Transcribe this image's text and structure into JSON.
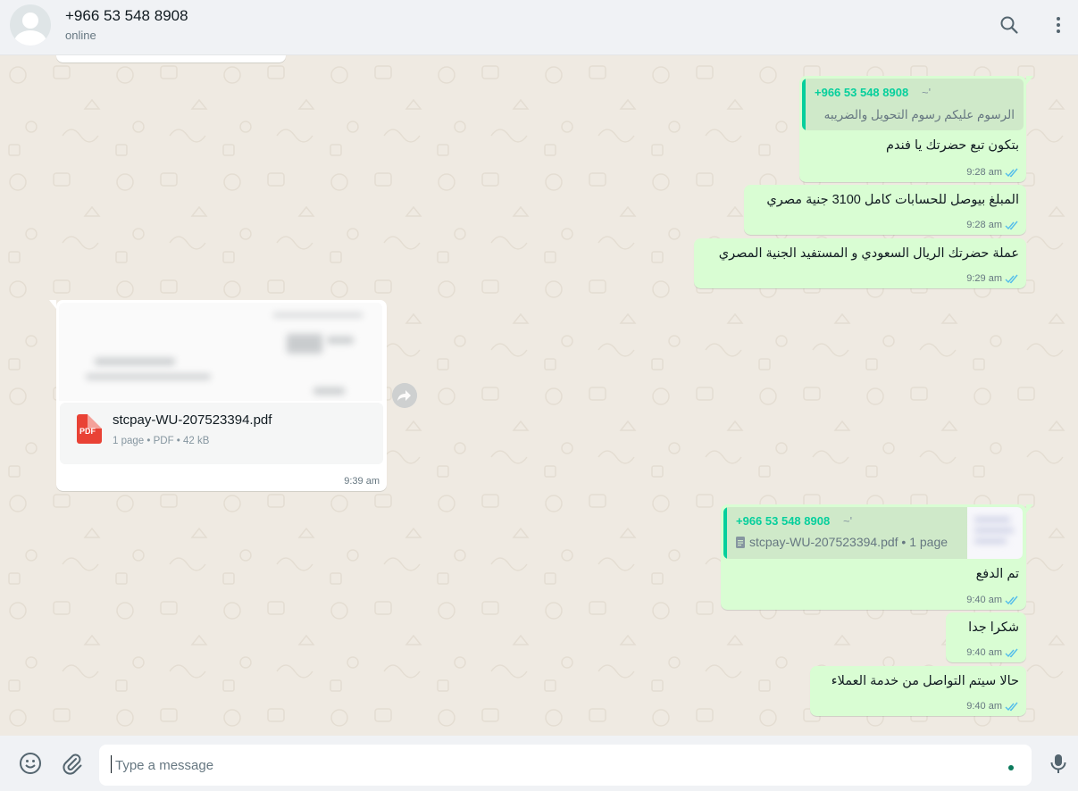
{
  "header": {
    "contact_name": "+966 53 548 8908",
    "status": "online"
  },
  "messages": {
    "m1": {
      "quote_author": "+966 53 548 8908",
      "quote_tilde": "~'",
      "quote_text": "الرسوم عليكم رسوم التحويل والضريبه",
      "text": "بتكون تبع حضرتك يا فندم",
      "time": "9:28 am"
    },
    "m2": {
      "text": "المبلغ بيوصل للحسابات كامل 3100 جنية مصري",
      "time": "9:28 am"
    },
    "m3": {
      "text": "عملة حضرتك الريال السعودي و المستفيد الجنية المصري",
      "time": "9:29 am"
    },
    "doc": {
      "file_name": "stcpay-WU-207523394.pdf",
      "icon_label": "PDF",
      "details": "1 page • PDF • 42 kB",
      "time": "9:39 am"
    },
    "m4": {
      "quote_author": "+966 53 548 8908",
      "quote_tilde": "~'",
      "quote_doc": "stcpay-WU-207523394.pdf • 1 page",
      "text": "تم الدفع",
      "time": "9:40 am"
    },
    "m5": {
      "text": "شكرا جدا",
      "time": "9:40 am"
    },
    "m6": {
      "text": "حالا سيتم التواصل من خدمة العملاء",
      "time": "9:40 am"
    }
  },
  "composer": {
    "placeholder": "Type a message"
  },
  "colors": {
    "outgoing_bubble": "#d9fdd3",
    "incoming_bubble": "#ffffff",
    "accent": "#06cf9c",
    "read_ticks": "#53bdeb",
    "chat_bg": "#efeae2"
  },
  "icons": {
    "header": [
      "search-icon",
      "menu-dots-icon"
    ],
    "composer": [
      "emoji-icon",
      "attach-icon",
      "mic-icon"
    ],
    "message": [
      "double-check-icon",
      "forward-icon",
      "pdf-icon",
      "document-icon"
    ]
  }
}
